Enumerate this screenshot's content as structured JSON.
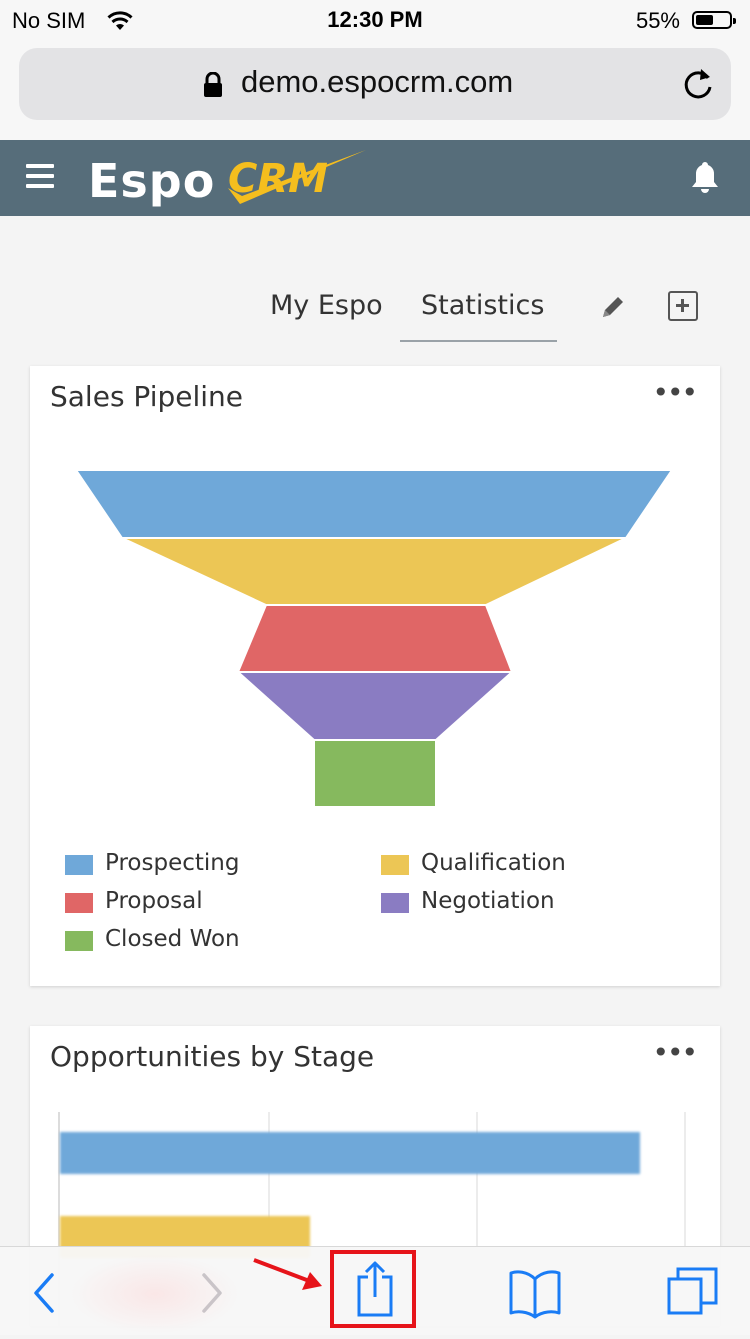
{
  "status": {
    "carrier": "No SIM",
    "time": "12:30 PM",
    "battery": "55%",
    "battery_level": 0.55
  },
  "browser": {
    "url": "demo.espocrm.com"
  },
  "app": {
    "logo_part1": "Espo",
    "logo_part2": "CRM"
  },
  "tabs": [
    {
      "label": "My Espo"
    },
    {
      "label": "Statistics"
    }
  ],
  "panel1": {
    "title": "Sales Pipeline",
    "menu": "•••"
  },
  "panel2": {
    "title": "Opportunities by Stage",
    "menu": "•••"
  },
  "chart_data": [
    {
      "type": "funnel",
      "title": "Sales Pipeline",
      "categories": [
        "Prospecting",
        "Qualification",
        "Proposal",
        "Negotiation",
        "Closed Won"
      ],
      "colors": [
        "#6fa8d9",
        "#ecc655",
        "#e06666",
        "#8a7cc2",
        "#86b95e"
      ],
      "legend": [
        {
          "label": "Prospecting",
          "color": "#6fa8d9"
        },
        {
          "label": "Qualification",
          "color": "#ecc655"
        },
        {
          "label": "Proposal",
          "color": "#e06666"
        },
        {
          "label": "Negotiation",
          "color": "#8a7cc2"
        },
        {
          "label": "Closed Won",
          "color": "#86b95e"
        }
      ]
    },
    {
      "type": "bar",
      "title": "Opportunities by Stage",
      "orientation": "horizontal",
      "grid": true,
      "bars": [
        {
          "color": "#6fa8d9",
          "fraction": 0.93
        },
        {
          "color": "#ecc655",
          "fraction": 0.4
        }
      ]
    }
  ]
}
